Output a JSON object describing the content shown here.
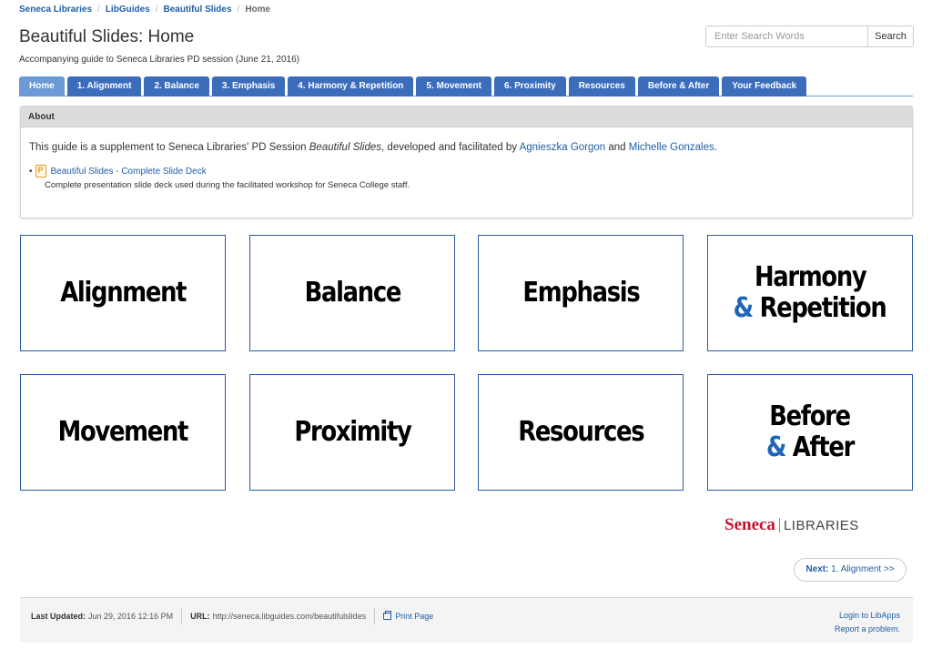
{
  "breadcrumb": {
    "items": [
      "Seneca Libraries",
      "LibGuides",
      "Beautiful Slides"
    ],
    "current": "Home",
    "separator": "/"
  },
  "page": {
    "title": "Beautiful Slides: Home",
    "subtitle": "Accompanying guide to Seneca Libraries PD session (June 21, 2016)"
  },
  "search": {
    "placeholder": "Enter Search Words",
    "button_label": "Search"
  },
  "tabs": [
    {
      "label": "Home",
      "active": true
    },
    {
      "label": "1. Alignment"
    },
    {
      "label": "2. Balance"
    },
    {
      "label": "3. Emphasis"
    },
    {
      "label": "4. Harmony & Repetition"
    },
    {
      "label": "5. Movement"
    },
    {
      "label": "6. Proximity"
    },
    {
      "label": "Resources"
    },
    {
      "label": "Before & After"
    },
    {
      "label": "Your Feedback"
    }
  ],
  "about": {
    "header": "About",
    "intro_prefix": "This guide is a supplement to Seneca Libraries' PD Session ",
    "intro_italic": "Beautiful Slides",
    "intro_mid": ", developed and facilitated by ",
    "author1": "Agnieszka Gorgon",
    "intro_and": " and ",
    "author2": "Michelle Gonzales",
    "intro_end": ".",
    "document_link": "Beautiful Slides - Complete Slide Deck",
    "document_desc": "Complete presentation slide deck used during the facilitated workshop for Seneca College staff."
  },
  "tiles": [
    {
      "line1": "Alignment"
    },
    {
      "line1": "Balance"
    },
    {
      "line1": "Emphasis"
    },
    {
      "line1": "Harmony",
      "amp": "&",
      "line2": " Repetition"
    },
    {
      "line1": "Movement"
    },
    {
      "line1": "Proximity"
    },
    {
      "line1": "Resources"
    },
    {
      "line1": "Before",
      "amp": "&",
      "line2": " After"
    }
  ],
  "logo": {
    "brand": "Seneca",
    "text": "LIBRARIES"
  },
  "next": {
    "label": "Next:",
    "target": " 1. Alignment >>"
  },
  "footer": {
    "updated_label": "Last Updated:",
    "updated_value": "Jun 29, 2016 12:16 PM",
    "url_label": "URL:",
    "url_value": "http://seneca.libguides.com/beautifulslides",
    "print": "Print Page",
    "login": "Login to LibApps",
    "report": "Report a problem."
  },
  "colors": {
    "tab_blue": "#3c6dbb",
    "tab_active": "#6b9ad6",
    "link": "#1f5ea8",
    "amp_blue": "#1f66b9",
    "brand_red": "#c8102e"
  }
}
